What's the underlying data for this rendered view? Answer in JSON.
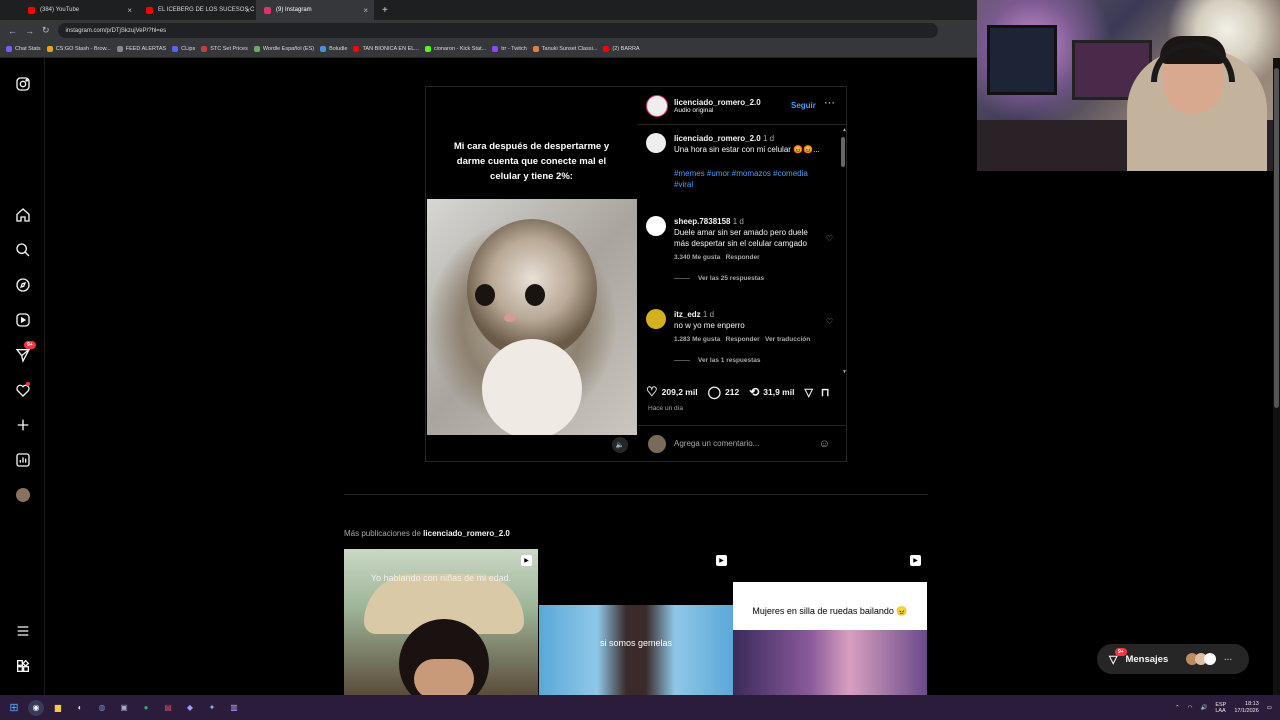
{
  "browser": {
    "tabs": [
      {
        "title": "(384) YouTube",
        "color": "#ff0000"
      },
      {
        "title": "EL ICEBERG DE LOS SUCESOS C",
        "color": "#ff0000"
      },
      {
        "title": "(9) Instagram",
        "color": "#e1306c",
        "active": true
      }
    ],
    "new_tab": "+",
    "url": "instagram.com/p/DTjSkzujVeP/?hl=es",
    "bookmarks": [
      "Chat Stats",
      "CS:GO Stash - Brow...",
      "FEED ALERTAS",
      "CLips",
      "STC Set Prices",
      "Wordle Español (ES)",
      "Boludle",
      "TAN BIONICA EN EL...",
      "cionaron - Kick Stat...",
      "trr - Twitch",
      "Tanuki Sunset Classi...",
      "(2) BARRA"
    ]
  },
  "sidebar": {
    "notifications_badge": "9+"
  },
  "post": {
    "image_caption": "Mi cara después de despertarme y darme cuenta que conecte mal el celular y tiene 2%:",
    "username": "licenciado_romero_2.0",
    "audio": "Audio original",
    "follow": "Seguir",
    "more": "···",
    "caption": {
      "username": "licenciado_romero_2.0",
      "time": "1 d",
      "text": "Una hora sin estar con mi celular 😡😡...",
      "hashtags": "#memes #umor #momazos #comedia #viral"
    },
    "comments": [
      {
        "username": "sheep.7838158",
        "time": "1 d",
        "text": "Duele amar sin ser amado pero duele más despertar sin el celular camgado",
        "likes": "3.340 Me gusta",
        "reply": "Responder",
        "replies": "Ver las 25 respuestas"
      },
      {
        "username": "itz_edz",
        "time": "1 d",
        "text": "no w yo me enperro",
        "likes": "1.283 Me gusta",
        "reply": "Responder",
        "translate": "Ver traducción",
        "replies": "Ver las 1 respuestas"
      }
    ],
    "likes": "209,2 mil",
    "comments_count": "212",
    "reposts": "31,9 mil",
    "posted": "Hace un día",
    "add_comment_placeholder": "Agrega un comentario..."
  },
  "more_posts": {
    "prefix": "Más publicaciones de",
    "username": "licenciado_romero_2.0",
    "items": [
      {
        "caption": "Yo hablando con niñas de mi edad."
      },
      {
        "caption": "si somos gemelas"
      },
      {
        "caption": "Mujeres en silla de ruedas bailando 😠"
      }
    ]
  },
  "messages": {
    "label": "Mensajes",
    "badge": "9+"
  },
  "taskbar": {
    "lang": "ESP\nLAA",
    "time": "18:13",
    "date": "17/1/2026"
  }
}
